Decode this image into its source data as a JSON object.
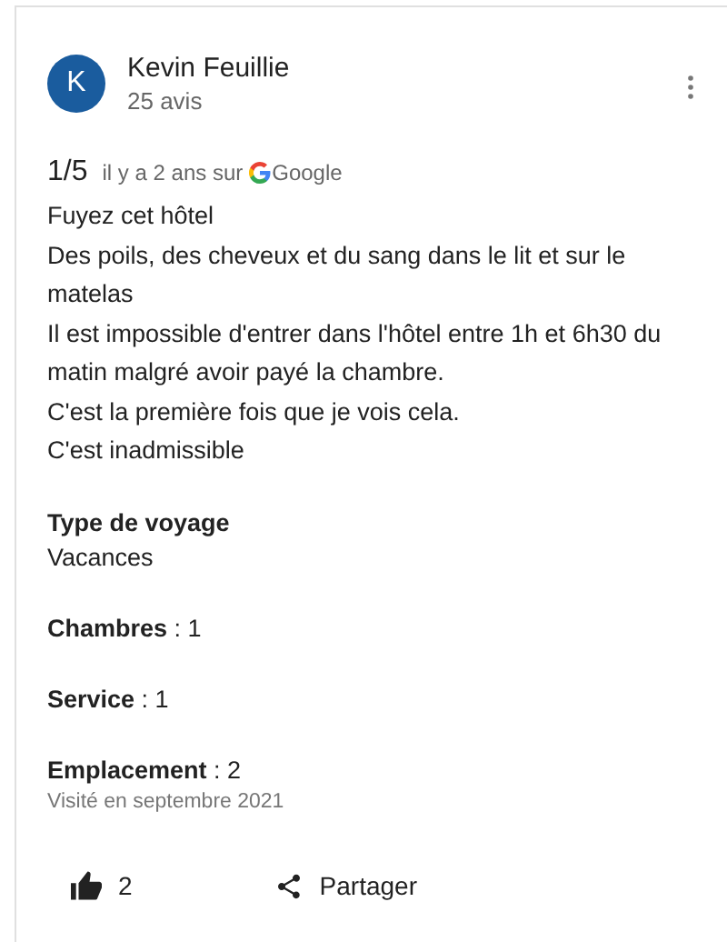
{
  "review": {
    "author": {
      "initial": "K",
      "name": "Kevin Feuillie",
      "reviews": "25 avis"
    },
    "rating": "1/5",
    "date": "il y a 2 ans sur",
    "source": "Google",
    "body": [
      "Fuyez cet hôtel",
      "Des poils, des cheveux et du sang dans le lit et sur le matelas",
      "Il est impossible d'entrer dans l'hôtel entre 1h et 6h30 du matin malgré avoir payé la chambre.",
      "C'est la première fois que je vois cela.",
      "C'est inadmissible"
    ],
    "trip_type": {
      "label": "Type de voyage",
      "value": "Vacances"
    },
    "ratings": [
      "**Chambres** : 1",
      "**Service** : 1",
      "**Emplacement** : 2"
    ],
    "visited": "Visité en septembre 2021",
    "likes": "2",
    "share": "Partager"
  }
}
